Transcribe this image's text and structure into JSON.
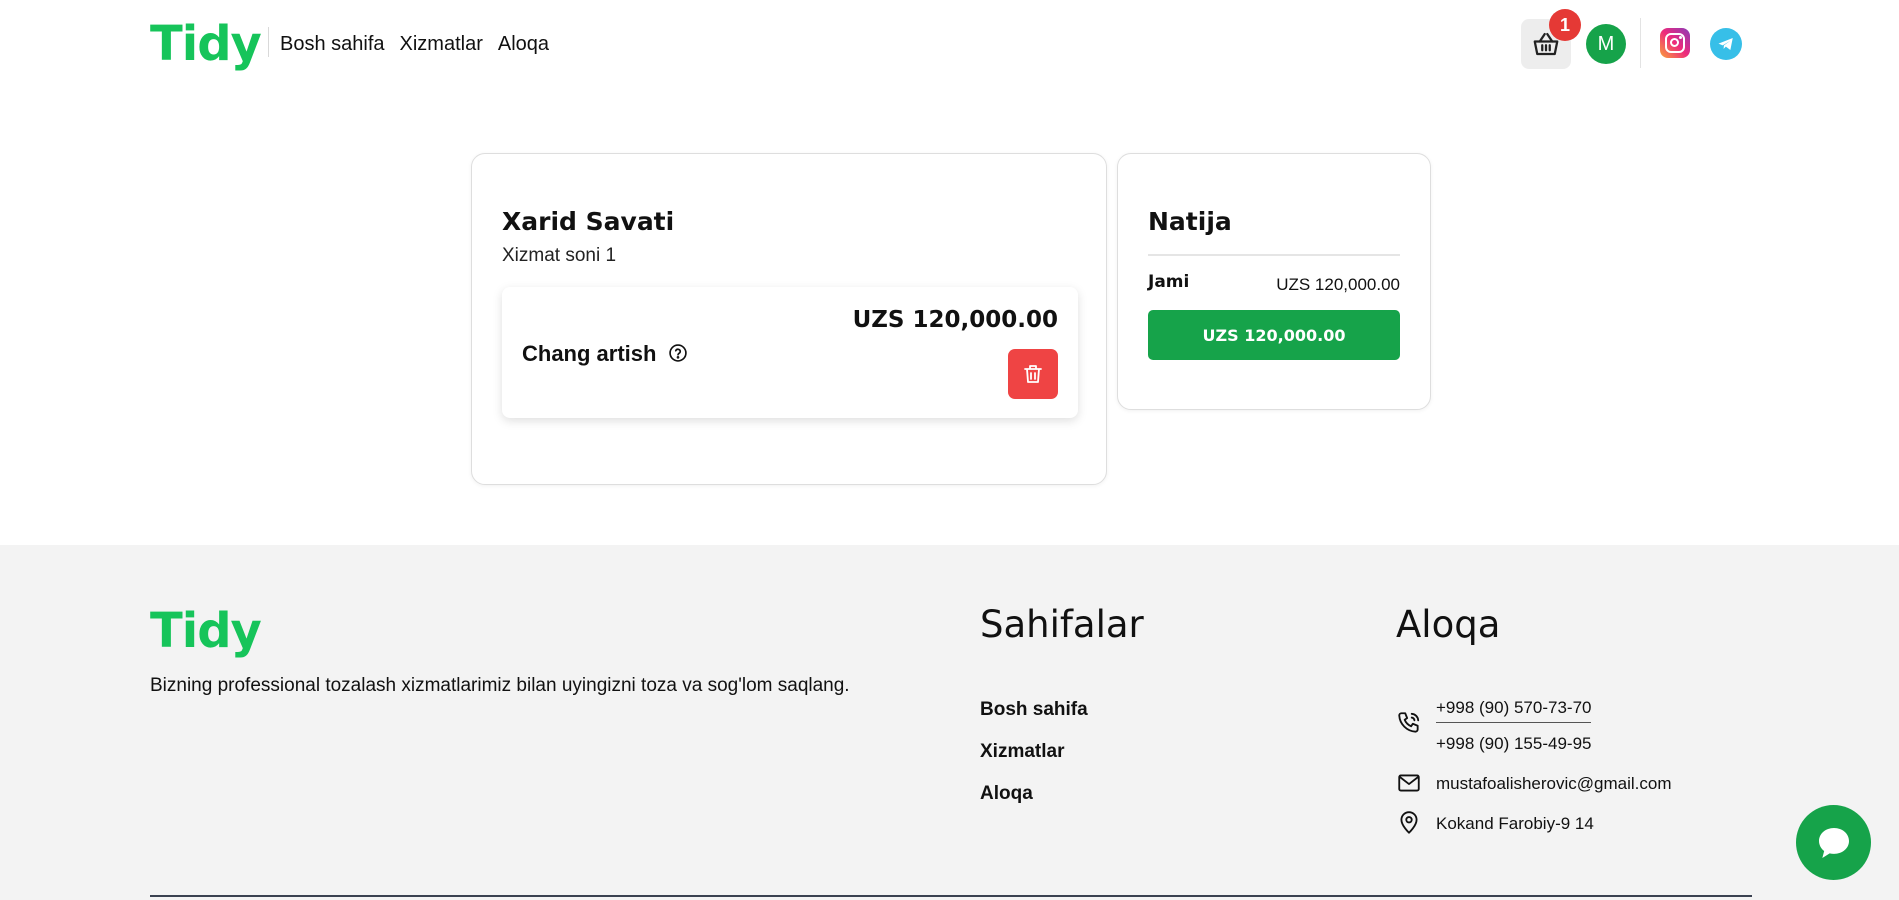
{
  "brand": {
    "name": "Tidy",
    "color": "#16c45a"
  },
  "nav": {
    "items": [
      "Bosh sahifa",
      "Xizmatlar",
      "Aloqa"
    ]
  },
  "header": {
    "cart_count": "1",
    "avatar_initial": "M"
  },
  "cart": {
    "title": "Xarid Savati",
    "subtitle": "Xizmat soni 1",
    "items": [
      {
        "name": "Chang artish",
        "price": "UZS 120,000.00"
      }
    ]
  },
  "result": {
    "title": "Natija",
    "total_label": "Jami",
    "total_value": "UZS 120,000.00",
    "checkout_label": "UZS 120,000.00"
  },
  "footer": {
    "description": "Bizning professional tozalash xizmatlarimiz bilan uyingizni toza va sog'lom saqlang.",
    "pages_heading": "Sahifalar",
    "pages": [
      "Bosh sahifa",
      "Xizmatlar",
      "Aloqa"
    ],
    "contact_heading": "Aloqa",
    "phone_1": "+998 (90) 570-73-70",
    "phone_2": "+998 (90) 155-49-95",
    "email": "mustafoalisherovic@gmail.com",
    "address": "Kokand Farobiy-9 14"
  },
  "icons": [
    "basket-icon",
    "instagram-icon",
    "telegram-icon",
    "help-icon",
    "trash-icon",
    "phone-icon",
    "mail-icon",
    "map-pin-icon",
    "chat-icon"
  ],
  "colors": {
    "accent": "#16a34a",
    "danger": "#ef4444",
    "badge": "#e53935",
    "footer_bg": "#f3f3f3"
  }
}
